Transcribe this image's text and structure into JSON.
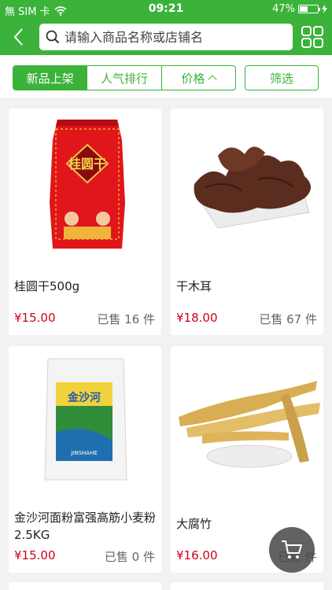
{
  "status": {
    "carrier": "無 SIM 卡",
    "time": "09:21",
    "battery": "47%",
    "battery_level": 0.47
  },
  "nav": {
    "search_placeholder": "请输入商品名称或店铺名"
  },
  "filters": {
    "tabs": [
      "新品上架",
      "人气排行",
      "价格"
    ],
    "active_index": 0,
    "filter_label": "筛选"
  },
  "products": [
    {
      "name": "桂圆干500g",
      "price": "¥15.00",
      "sold_prefix": "已售",
      "sold_count": "16",
      "sold_unit": "件",
      "image": "longan-bag"
    },
    {
      "name": "干木耳",
      "price": "¥18.00",
      "sold_prefix": "已售",
      "sold_count": "67",
      "sold_unit": "件",
      "image": "wood-ear-fungus"
    },
    {
      "name": "金沙河面粉富强高筋小麦粉2.5KG",
      "price": "¥15.00",
      "sold_prefix": "已售",
      "sold_count": "0",
      "sold_unit": "件",
      "image": "flour-bag",
      "bag_brand": "金沙河",
      "bag_sub": "JINSHAHE"
    },
    {
      "name": "大腐竹",
      "price": "¥16.00",
      "sold_prefix": "已售",
      "sold_count": "",
      "sold_unit": "件",
      "image": "tofu-skin"
    }
  ],
  "icons": {
    "back": "back-arrow-icon",
    "search": "search-icon",
    "grid": "grid-menu-icon",
    "cart": "cart-icon"
  },
  "colors": {
    "primary": "#3bb33a",
    "price": "#d0021b"
  }
}
